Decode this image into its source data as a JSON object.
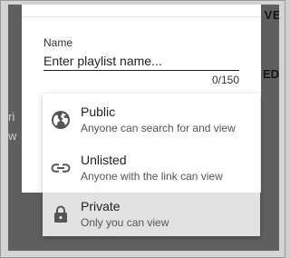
{
  "background": {
    "header_fragment": "VE",
    "tab_fragment": "ED",
    "left_fragment_1": "ri",
    "left_fragment_2": "w"
  },
  "dialog": {
    "name_label": "Name",
    "name_value": "",
    "name_placeholder": "Enter playlist name...",
    "char_count": "0/150"
  },
  "visibility_menu": {
    "items": [
      {
        "icon": "globe-icon",
        "title": "Public",
        "subtitle": "Anyone can search for and view"
      },
      {
        "icon": "link-icon",
        "title": "Unlisted",
        "subtitle": "Anyone with the link can view"
      },
      {
        "icon": "lock-icon",
        "title": "Private",
        "subtitle": "Only you can view"
      }
    ],
    "selected": "Private"
  },
  "colors": {
    "overlay": "#5f5f5f",
    "selected_item": "#e2e2e2",
    "icon": "#555555"
  }
}
